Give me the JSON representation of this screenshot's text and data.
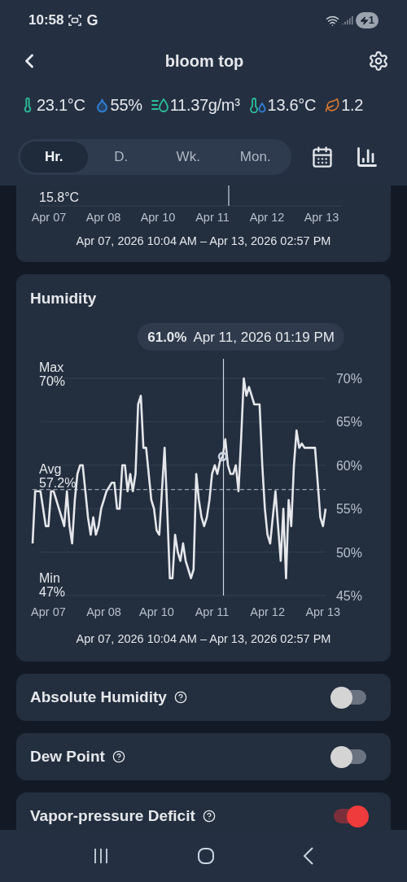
{
  "status_bar": {
    "time": "10:58",
    "notification": "G",
    "battery": "1"
  },
  "header": {
    "title": "bloom top"
  },
  "readings": [
    {
      "kind": "temperature",
      "value": "23.1°C",
      "color": "#2dbf9a"
    },
    {
      "kind": "humidity",
      "value": "55%",
      "color": "#2f7fd6"
    },
    {
      "kind": "absolute_humidity",
      "value": "11.37g/m³",
      "color": "#2dbf9a"
    },
    {
      "kind": "dew_point",
      "value": "13.6°C",
      "color": "#2dbf9a"
    },
    {
      "kind": "vpd",
      "value": "1.2",
      "color": "#e07a2f"
    }
  ],
  "range_tabs": [
    {
      "label": "Hr.",
      "selected": true
    },
    {
      "label": "D.",
      "selected": false
    },
    {
      "label": "Wk.",
      "selected": false
    },
    {
      "label": "Mon.",
      "selected": false
    }
  ],
  "temperature_card": {
    "min_value": "15.8°C",
    "x_labels": [
      "Apr 07",
      "Apr 08",
      "Apr 10",
      "Apr 11",
      "Apr 12",
      "Apr 13"
    ],
    "range": "Apr 07, 2026 10:04 AM – Apr 13, 2026 02:57 PM"
  },
  "humidity_card": {
    "title": "Humidity",
    "tooltip": {
      "value": "61.0%",
      "time": "Apr 11, 2026 01:19 PM"
    },
    "stats": [
      {
        "label": "Max",
        "value": "70%"
      },
      {
        "label": "Avg",
        "value": "57.2%"
      },
      {
        "label": "Min",
        "value": "47%"
      }
    ],
    "chart_data": {
      "type": "line",
      "grid": true,
      "ylim": [
        45,
        70
      ],
      "yticks": [
        {
          "value": 70,
          "label": "70%"
        },
        {
          "value": 65,
          "label": "65%"
        },
        {
          "value": 60,
          "label": "60%"
        },
        {
          "value": 55,
          "label": "55%"
        },
        {
          "value": 50,
          "label": "50%"
        },
        {
          "value": 45,
          "label": "45%"
        }
      ],
      "categories": [
        null,
        null,
        null,
        null,
        null,
        null,
        "Apr 07",
        null,
        null,
        null,
        null,
        null,
        null,
        null,
        null,
        null,
        null,
        null,
        null,
        null,
        null,
        null,
        null,
        null,
        null,
        null,
        null,
        "Apr 08",
        null,
        null,
        null,
        null,
        null,
        null,
        null,
        null,
        null,
        null,
        null,
        null,
        null,
        null,
        null,
        null,
        null,
        null,
        null,
        "Apr 10",
        null,
        null,
        null,
        null,
        null,
        null,
        null,
        null,
        null,
        null,
        null,
        null,
        null,
        null,
        null,
        null,
        null,
        null,
        null,
        null,
        "Apr 11",
        null,
        null,
        null,
        null,
        null,
        null,
        null,
        null,
        null,
        null,
        null,
        null,
        null,
        null,
        null,
        null,
        null,
        null,
        null,
        null,
        "Apr 12",
        null,
        null,
        null,
        null,
        null,
        null,
        null,
        null,
        null,
        null,
        null,
        null,
        null,
        null,
        null,
        null,
        null,
        null,
        null,
        null,
        "Apr 13",
        null
      ],
      "series": [
        {
          "color": "#e5e7eb",
          "values": [
            51,
            57,
            57,
            57,
            55,
            53,
            53,
            57,
            57,
            56,
            55,
            54,
            53,
            57,
            53,
            51,
            56,
            59,
            60,
            60,
            57,
            54,
            52,
            54,
            52,
            53,
            55,
            56,
            57,
            57.5,
            58,
            58,
            55,
            55,
            60,
            60,
            57,
            59,
            57,
            59,
            67,
            68,
            62,
            62,
            59,
            56,
            55,
            52.5,
            52,
            57,
            62,
            55,
            47,
            47,
            52,
            50,
            49,
            51,
            49,
            48,
            47,
            48,
            59,
            56,
            54,
            53,
            54,
            56,
            59,
            60,
            59,
            60.5,
            61,
            63,
            60,
            59,
            59,
            60,
            57,
            63,
            70,
            68,
            69,
            68,
            67,
            67,
            67,
            60,
            55,
            52,
            51,
            54,
            57,
            53,
            49,
            55,
            47,
            56,
            53,
            60,
            64,
            62,
            62.5,
            62,
            62,
            62,
            62,
            62,
            58,
            54,
            53,
            55
          ]
        },
        {
          "color": "#9aa3ae",
          "line_style": "dashed",
          "values": [
            57.2,
            57.2,
            57.2,
            57.2,
            57.2,
            57.2,
            57.2,
            57.2,
            57.2,
            57.2,
            57.2,
            57.2,
            57.2,
            57.2,
            57.2,
            57.2,
            57.2,
            57.2,
            57.2,
            57.2,
            57.2,
            57.2,
            57.2,
            57.2,
            57.2,
            57.2,
            57.2,
            57.2,
            57.2,
            57.2,
            57.2,
            57.2,
            57.2,
            57.2,
            57.2,
            57.2,
            57.2,
            57.2,
            57.2,
            57.2,
            57.2,
            57.2,
            57.2,
            57.2,
            57.2,
            57.2,
            57.2,
            57.2,
            57.2,
            57.2,
            57.2,
            57.2,
            57.2,
            57.2,
            57.2,
            57.2,
            57.2,
            57.2,
            57.2,
            57.2,
            57.2,
            57.2,
            57.2,
            57.2,
            57.2,
            57.2,
            57.2,
            57.2,
            57.2,
            57.2,
            57.2,
            57.2,
            57.2,
            57.2,
            57.2,
            57.2,
            57.2,
            57.2,
            57.2,
            57.2,
            57.2,
            57.2,
            57.2,
            57.2,
            57.2,
            57.2,
            57.2,
            57.2,
            57.2,
            57.2,
            57.2,
            57.2,
            57.2,
            57.2,
            57.2,
            57.2,
            57.2,
            57.2,
            57.2,
            57.2,
            57.2,
            57.2,
            57.2,
            57.2,
            57.2,
            57.2,
            57.2,
            57.2,
            57.2,
            57.2,
            57.2,
            57.2
          ]
        },
        {
          "color": "#cbd5e1",
          "marker": "circle",
          "values": [
            null,
            null,
            null,
            null,
            null,
            null,
            null,
            null,
            null,
            null,
            null,
            null,
            null,
            null,
            null,
            null,
            null,
            null,
            null,
            null,
            null,
            null,
            null,
            null,
            null,
            null,
            null,
            null,
            null,
            null,
            null,
            null,
            null,
            null,
            null,
            null,
            null,
            null,
            null,
            null,
            null,
            null,
            null,
            null,
            null,
            null,
            null,
            null,
            null,
            null,
            null,
            null,
            null,
            null,
            null,
            null,
            null,
            null,
            null,
            null,
            null,
            null,
            null,
            null,
            null,
            null,
            null,
            null,
            null,
            null,
            null,
            null,
            61,
            null,
            null,
            null,
            null,
            null,
            null,
            null,
            null,
            null,
            null,
            null,
            null,
            null,
            null,
            null,
            null,
            null,
            null,
            null,
            null,
            null,
            null,
            null,
            null,
            null,
            null,
            null,
            null,
            null,
            null,
            null,
            null,
            null,
            null,
            null,
            null,
            null,
            null,
            null
          ]
        }
      ]
    },
    "range": "Apr 07, 2026 10:04 AM – Apr 13, 2026 02:57 PM"
  },
  "toggles": [
    {
      "label": "Absolute Humidity",
      "on": false
    },
    {
      "label": "Dew Point",
      "on": false
    },
    {
      "label": "Vapor-pressure Deficit",
      "on": true
    }
  ]
}
